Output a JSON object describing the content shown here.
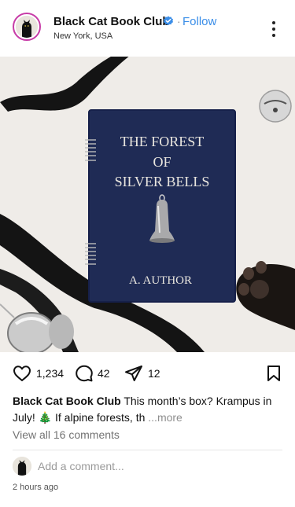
{
  "post": {
    "account_name": "Black Cat Book Club",
    "separator": "·",
    "follow_label": "Follow",
    "location": "New York, USA",
    "more_icon": "more-vertical-icon"
  },
  "image": {
    "book_title_lines": [
      "THE FOREST",
      "OF",
      "SILVER BELLS"
    ],
    "book_author": "A. AUTHOR",
    "colors": {
      "background": "#efece8",
      "book_cover": "#1f2b55",
      "ribbon": "#141414"
    }
  },
  "actions": {
    "likes": "1,234",
    "comments": "42",
    "shares": "12"
  },
  "caption": {
    "account_name": "Black Cat Book Club",
    "text": "This month’s box? Krampus in July! 🎄 If alpine forests, th",
    "more_label": "...more"
  },
  "comments": {
    "view_all": "View all 16 comments",
    "placeholder": "Add a comment..."
  },
  "timestamp": "2 hours ago",
  "colors": {
    "accent": "#3b8ee8",
    "story_ring": "#c73ba7"
  }
}
